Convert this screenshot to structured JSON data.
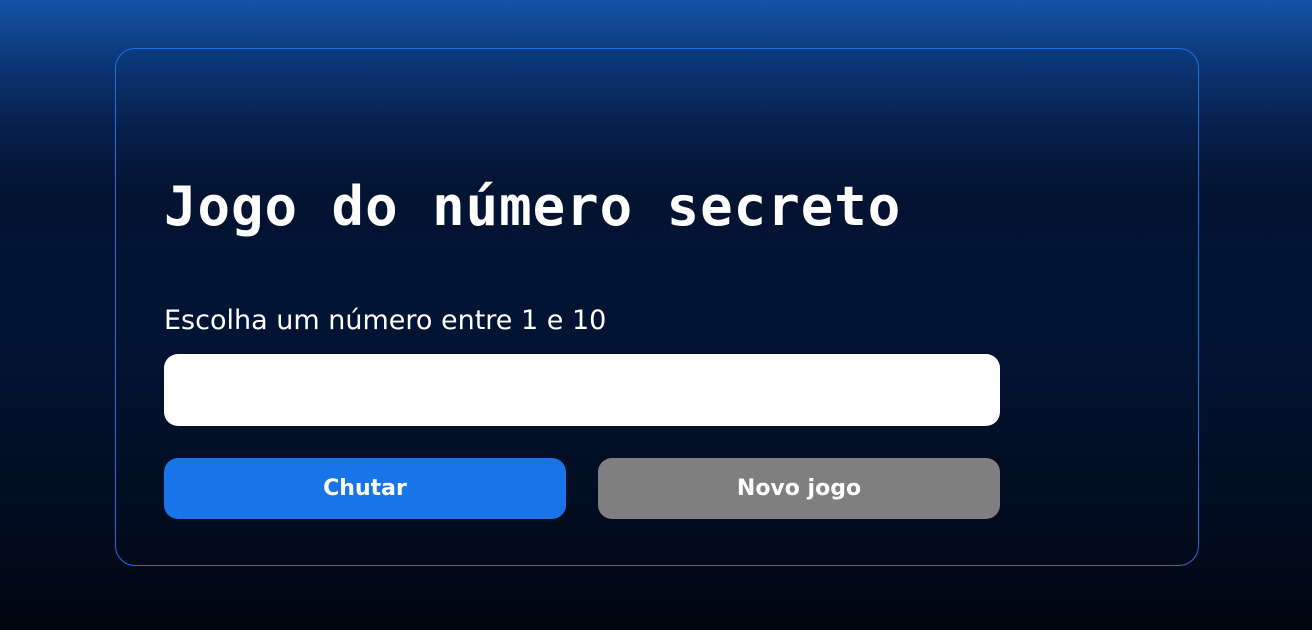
{
  "game": {
    "title": "Jogo do número secreto",
    "prompt": "Escolha um número entre 1 e 10",
    "guess_input": {
      "value": "",
      "placeholder": ""
    },
    "buttons": {
      "guess_label": "Chutar",
      "new_game_label": "Novo jogo"
    }
  },
  "colors": {
    "background_top": "#1354a5",
    "background_bottom": "#00060f",
    "container_border": "#1b6fe6",
    "guess_button": "#1875e8",
    "new_game_button": "#7f7f7f",
    "input_background": "#ffffff",
    "text": "#ffffff"
  }
}
